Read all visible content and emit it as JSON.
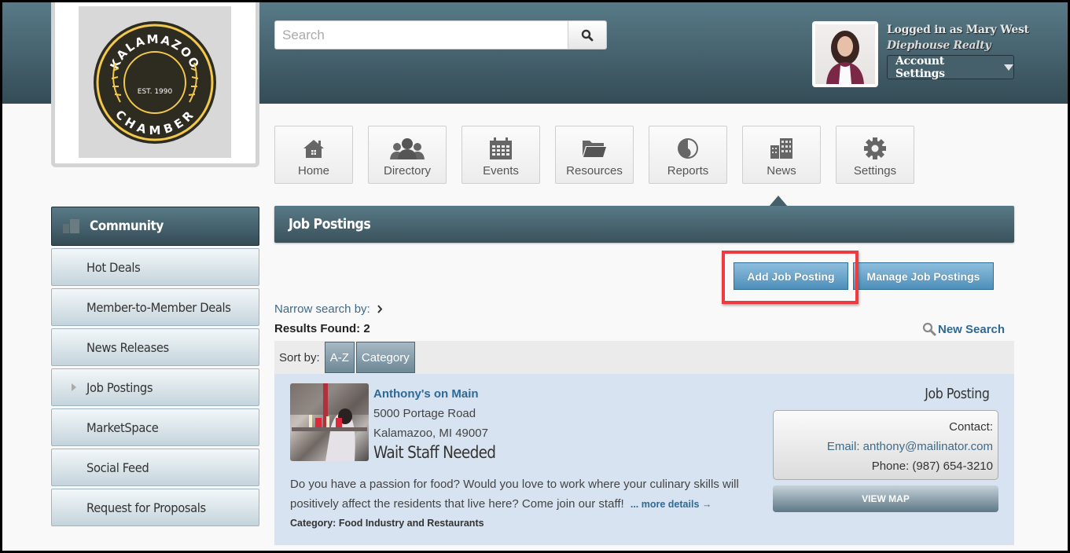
{
  "header": {
    "logo": {
      "top_text": "KALAMAZOO",
      "middle_text": "EST. 1990",
      "bottom_text": "CHAMBER",
      "ring_color": "#f2c94c",
      "bg_color": "#2e2b20"
    },
    "search": {
      "placeholder": "Search",
      "value": "",
      "icon": "search-icon"
    },
    "user": {
      "logged_in_text": "Logged in as Mary West",
      "company": "Diephouse Realty",
      "account_settings_label": "Account Settings"
    }
  },
  "nav": {
    "tiles": [
      {
        "label": "Home",
        "icon": "home-icon"
      },
      {
        "label": "Directory",
        "icon": "users-icon"
      },
      {
        "label": "Events",
        "icon": "calendar-icon"
      },
      {
        "label": "Resources",
        "icon": "folder-icon"
      },
      {
        "label": "Reports",
        "icon": "pie-chart-icon"
      },
      {
        "label": "News",
        "icon": "buildings-icon",
        "active": true
      },
      {
        "label": "Settings",
        "icon": "gear-icon"
      }
    ]
  },
  "sidebar": {
    "heading": "Community",
    "items": [
      {
        "label": "Hot Deals"
      },
      {
        "label": "Member-to-Member Deals"
      },
      {
        "label": "News Releases"
      },
      {
        "label": "Job Postings",
        "active": true
      },
      {
        "label": "MarketSpace"
      },
      {
        "label": "Social Feed"
      },
      {
        "label": "Request for Proposals"
      }
    ]
  },
  "main": {
    "title": "Job Postings",
    "add_button": "Add Job Posting",
    "manage_button": "Manage Job Postings",
    "narrow_search": "Narrow search by:",
    "results_found": "Results Found: 2",
    "new_search": "New Search",
    "sort": {
      "label": "Sort by:",
      "options": [
        "A-Z",
        "Category"
      ]
    },
    "listings": [
      {
        "business": "Anthony's on Main",
        "address_line1": "5000 Portage Road",
        "address_line2": "Kalamazoo, MI 49007",
        "title": "Wait Staff Needed",
        "description": "Do you have a passion for food? Would you love to work where your culinary skills will positively affect the residents that live here? Come join our staff!",
        "more_details": "... more details →",
        "category": "Category: Food Industry and Restaurants",
        "type": "Job Posting",
        "contact_label": "Contact:",
        "email": "Email: anthony@mailinator.com",
        "phone": "Phone: (987) 654-3210",
        "view_map": "VIEW MAP"
      }
    ]
  },
  "colors": {
    "header_top": "#587a87",
    "header_bottom": "#344c56",
    "link_blue": "#2e6a95",
    "button_blue": "#4d8fba",
    "highlight_red": "#ef3b3f",
    "listing_bg": "#d7e3f0"
  }
}
